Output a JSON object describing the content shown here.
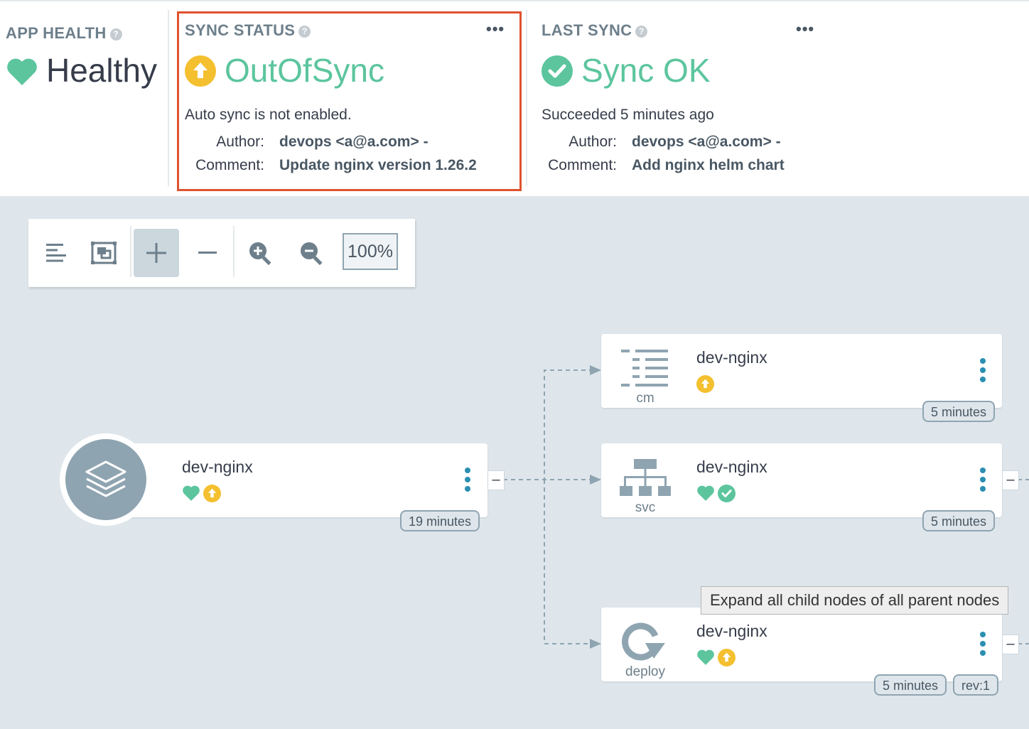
{
  "app_health": {
    "label": "APP HEALTH",
    "status": "Healthy"
  },
  "sync_status": {
    "label": "SYNC STATUS",
    "status": "OutOfSync",
    "message": "Auto sync is not enabled.",
    "author_label": "Author:",
    "author": "devops <a@a.com> -",
    "comment_label": "Comment:",
    "comment": "Update nginx version 1.26.2"
  },
  "last_sync": {
    "label": "LAST SYNC",
    "status": "Sync OK",
    "message": "Succeeded 5 minutes ago",
    "author_label": "Author:",
    "author": "devops <a@a.com> -",
    "comment_label": "Comment:",
    "comment": "Add nginx helm chart"
  },
  "help_glyph": "?",
  "more_glyph": "•••",
  "toolbar": {
    "zoom": "100%"
  },
  "colors": {
    "healthy": "#5cc59e",
    "out_of_sync": "#f4c030",
    "highlight": "#e0522f",
    "link": "#2b8fb1",
    "icon_gray": "#8fa4b1"
  },
  "nodes": {
    "app": {
      "name": "dev-nginx",
      "age": "19 minutes",
      "icon": "layers-icon",
      "health": "healthy",
      "sync": "out-of-sync"
    },
    "cm": {
      "name": "dev-nginx",
      "kind": "cm",
      "age": "5 minutes",
      "icon": "configmap-icon",
      "sync": "out-of-sync"
    },
    "svc": {
      "name": "dev-nginx",
      "kind": "svc",
      "age": "5 minutes",
      "icon": "service-icon",
      "health": "healthy",
      "sync": "synced"
    },
    "deploy": {
      "name": "dev-nginx",
      "kind": "deploy",
      "age": "5 minutes",
      "rev": "rev:1",
      "icon": "deployment-icon",
      "health": "healthy",
      "sync": "out-of-sync"
    }
  },
  "toggle_glyph": "–",
  "tooltip": "Expand all child nodes of all parent nodes"
}
